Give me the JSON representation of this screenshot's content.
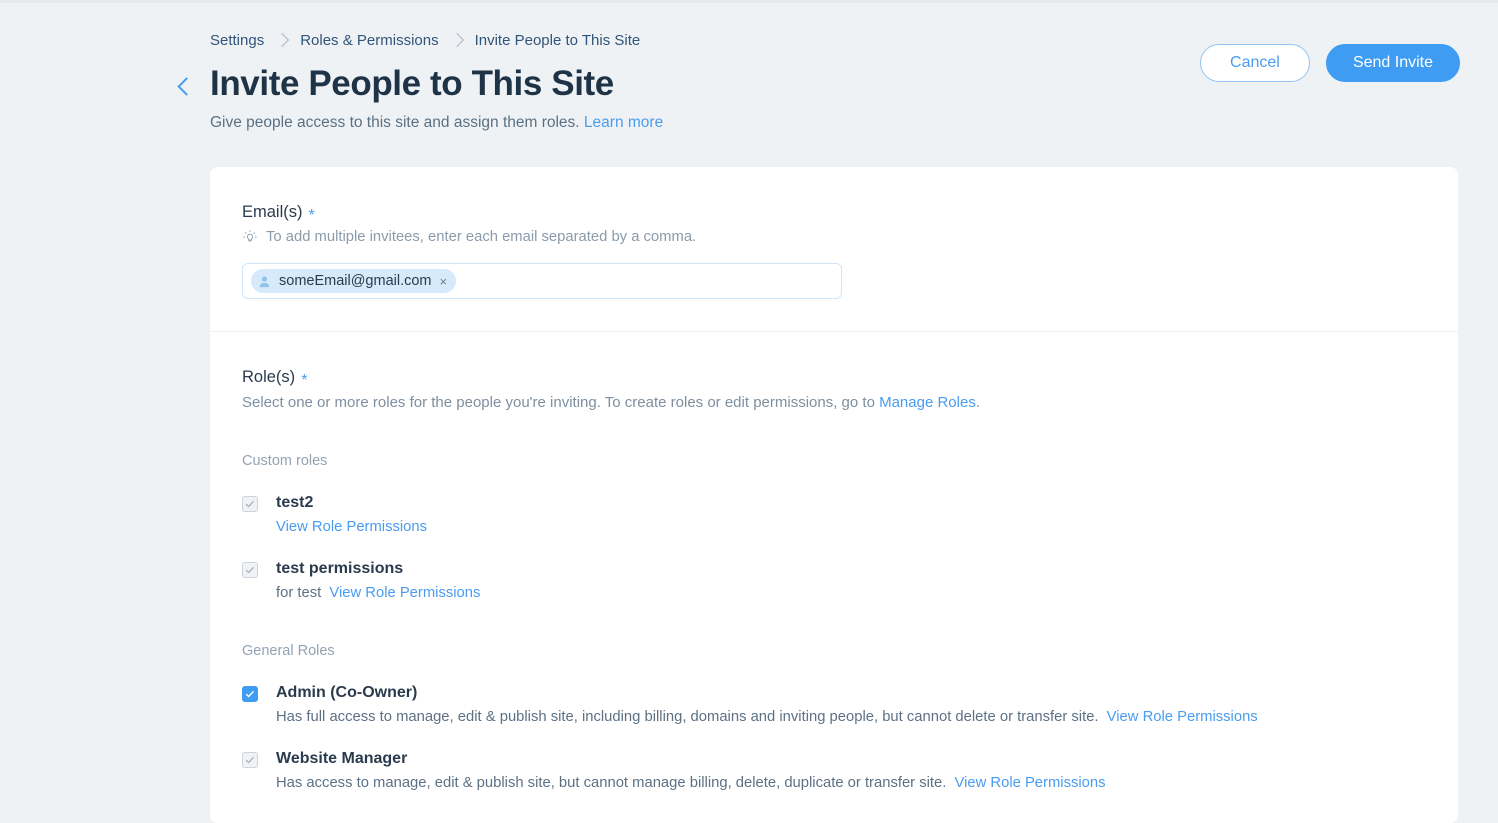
{
  "breadcrumb": {
    "items": [
      {
        "label": "Settings"
      },
      {
        "label": "Roles & Permissions"
      },
      {
        "label": "Invite People to This Site"
      }
    ]
  },
  "header": {
    "title": "Invite People to This Site",
    "subtitle": "Give people access to this site and assign them roles.",
    "learn_more": "Learn more",
    "back_icon": "chevron-left-icon",
    "cancel_label": "Cancel",
    "send_label": "Send Invite"
  },
  "email_section": {
    "label": "Email(s)",
    "required_mark": "*",
    "hint_icon": "lightbulb-icon",
    "hint": "To add multiple invitees, enter each email separated by a comma.",
    "chips": [
      {
        "icon": "person-icon",
        "email": "someEmail@gmail.com",
        "remove": "×"
      }
    ],
    "placeholder": ""
  },
  "roles_section": {
    "label": "Role(s)",
    "required_mark": "*",
    "description_before": "Select one or more roles for the people you're inviting. To create roles or edit permissions, go to ",
    "manage_roles_link": "Manage Roles",
    "description_after": ".",
    "custom_group_label": "Custom roles",
    "general_group_label": "General Roles",
    "custom_roles": [
      {
        "name": "test2",
        "checked": false,
        "disabled": true,
        "description": "",
        "link": "View Role Permissions"
      },
      {
        "name": "test permissions",
        "checked": false,
        "disabled": true,
        "description": "for test",
        "link": "View Role Permissions"
      }
    ],
    "general_roles": [
      {
        "name": "Admin (Co-Owner)",
        "checked": true,
        "disabled": false,
        "description": "Has full access to manage, edit & publish site, including billing, domains and inviting people, but cannot delete or transfer site.",
        "link": "View Role Permissions"
      },
      {
        "name": "Website Manager",
        "checked": false,
        "disabled": true,
        "description": "Has access to manage, edit & publish site, but cannot manage billing, delete, duplicate or transfer site.",
        "link": "View Role Permissions"
      }
    ]
  },
  "colors": {
    "accent": "#3e9cf3",
    "link": "#4a9cf0",
    "page_bg": "#eff2f5",
    "card_bg": "#ffffff",
    "chip_bg": "#d6eafc",
    "text": "#2b3b4e",
    "muted": "#8a9bab"
  }
}
